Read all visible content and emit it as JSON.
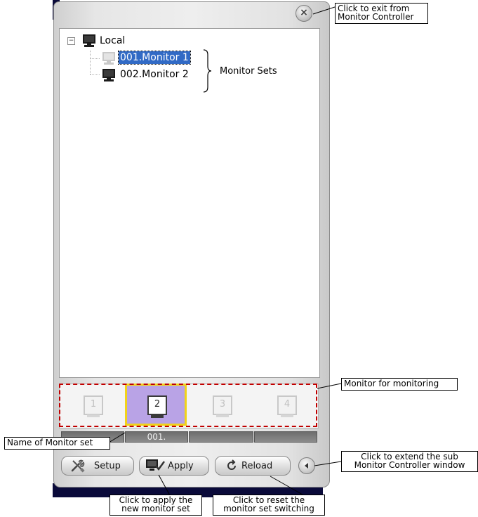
{
  "window": {
    "close_glyph": "×"
  },
  "tree": {
    "expander_glyph": "−",
    "root_label": "Local",
    "items": [
      {
        "label": "001.Monitor 1",
        "selected": true
      },
      {
        "label": "002.Monitor 2",
        "selected": false
      }
    ]
  },
  "monitors": {
    "cells": [
      {
        "number": "1",
        "active": false
      },
      {
        "number": "2",
        "active": true
      },
      {
        "number": "3",
        "active": false
      },
      {
        "number": "4",
        "active": false
      }
    ],
    "name_slots": [
      "",
      "001.",
      "",
      ""
    ]
  },
  "buttons": {
    "setup": "Setup",
    "apply": "Apply",
    "reload": "Reload"
  },
  "annotations": {
    "exit_line1": "Click to exit from",
    "exit_line2": "Monitor Controller",
    "monitor_sets": "Monitor Sets",
    "monitor_for_monitoring": "Monitor for monitoring",
    "name_of_set": "Name of Monitor set",
    "extend_line1": "Click to extend the sub",
    "extend_line2": "Monitor Controller window",
    "apply_line1": "Click to apply the",
    "apply_line2": "new monitor set",
    "reset_line1": "Click to reset the",
    "reset_line2": "monitor set switching"
  },
  "colors": {
    "selection": "#316ac5",
    "active_monitor_bg": "#b9a3e6",
    "active_monitor_border": "#f2d31a",
    "dashed_outline": "#c00000"
  }
}
